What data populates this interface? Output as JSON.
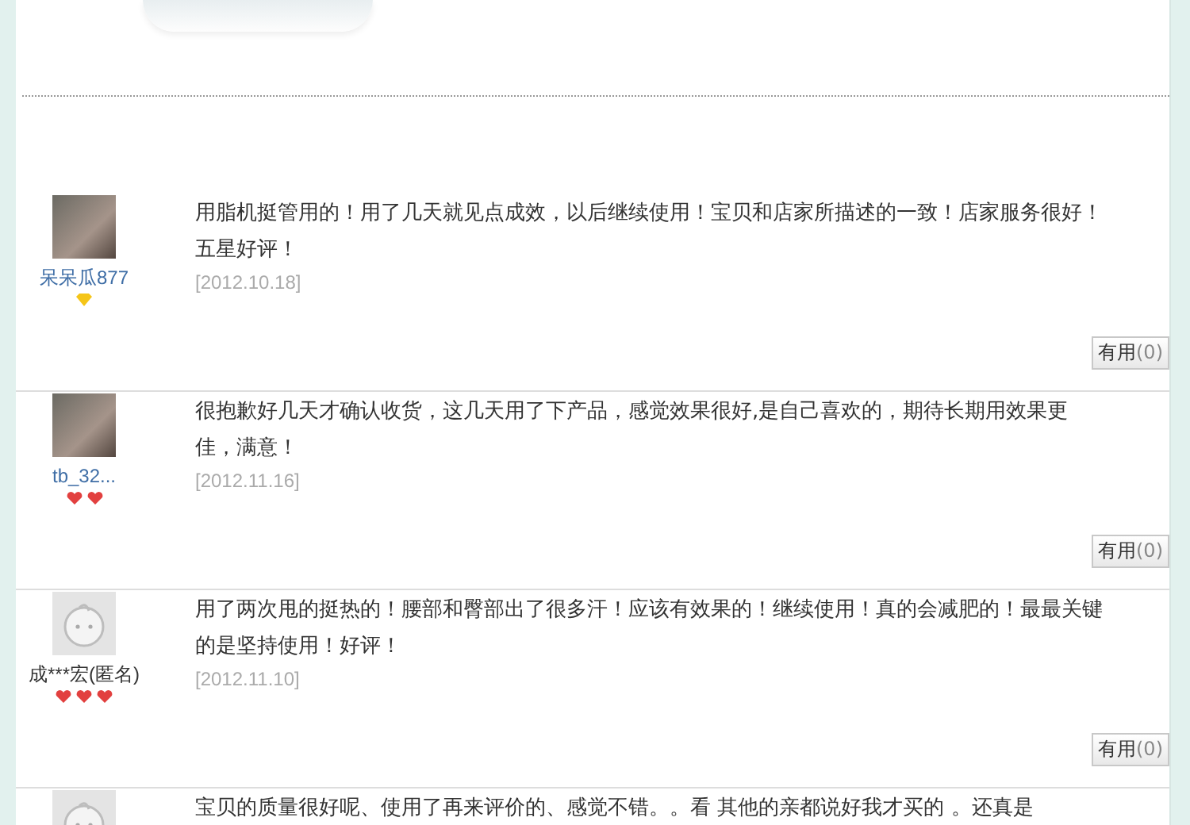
{
  "reviews": [
    {
      "has_photo": true,
      "user": "呆呆瓜877",
      "rank_icons": [
        {
          "kind": "diamond",
          "color": "#f5c518"
        }
      ],
      "text": "用脂机挺管用的！用了几天就见点成效，以后继续使用！宝贝和店家所描述的一致！店家服务很好！五星好评！",
      "date": "[2012.10.18]",
      "useful_label": "有用",
      "useful_count": "(0)"
    },
    {
      "has_photo": true,
      "user": "tb_32...",
      "rank_icons": [
        {
          "kind": "heart",
          "color": "#e2403f"
        },
        {
          "kind": "heart",
          "color": "#e2403f"
        }
      ],
      "text": "很抱歉好几天才确认收货，这几天用了下产品，感觉效果很好,是自己喜欢的，期待长期用效果更佳，满意！",
      "date": "[2012.11.16]",
      "useful_label": "有用",
      "useful_count": "(0)"
    },
    {
      "has_photo": false,
      "user": "成***宏(匿名)",
      "rank_icons": [
        {
          "kind": "heart",
          "color": "#e2403f"
        },
        {
          "kind": "heart",
          "color": "#e2403f"
        },
        {
          "kind": "heart",
          "color": "#e2403f"
        }
      ],
      "text": "用了两次甩的挺热的！腰部和臀部出了很多汗！应该有效果的！继续使用！真的会减肥的！最最关键的是坚持使用！好评！",
      "date": "[2012.11.10]",
      "useful_label": "有用",
      "useful_count": "(0)"
    },
    {
      "has_photo": false,
      "text": "宝贝的质量很好呢、使用了再来评价的、感觉不错。。看 其他的亲都说好我才买的 。还真是"
    }
  ]
}
